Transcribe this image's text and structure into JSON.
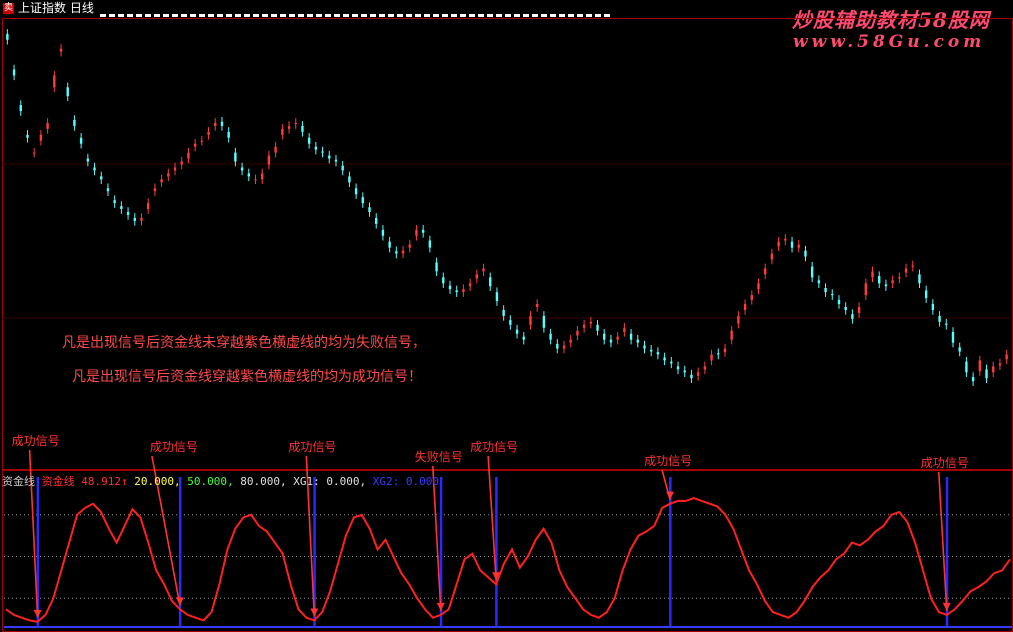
{
  "title_bar": {
    "icon_label": "卖",
    "title": "上证指数 日线"
  },
  "watermark": {
    "line1": "炒股辅助教材58股网",
    "line2": "www.58Gu.com"
  },
  "notes": [
    "凡是出现信号后资金线未穿越紫色横虚线的均为失败信号，",
    "凡是出现信号后资金线穿越紫色横虚线的均为成功信号！"
  ],
  "indicator_header": {
    "panel_name": "资金线",
    "series_name": "资金线",
    "value": "48.912",
    "arrow": "↑",
    "level1": "20.000,",
    "level2": "50.000,",
    "level3": "80.000,",
    "xg_label": "XG1:",
    "xg_value": "0.000,",
    "extra_label": "XG2:",
    "extra_value": "0.000"
  },
  "colors": {
    "background": "#000000",
    "frame": "#a00000",
    "candle_up": "#ff3b3b",
    "candle_down": "#54ffff",
    "line": "#ff2020",
    "signal_bar": "#2a2aff",
    "arrow": "#ff3333",
    "grid_dots": "#9a9a9a"
  },
  "chart_data": [
    {
      "type": "candlestick",
      "title": "上证指数 日线",
      "description_series": "close",
      "close": [
        2050,
        1990,
        1930,
        1885,
        1860,
        1890,
        1910,
        1990,
        2035,
        1955,
        1905,
        1875,
        1845,
        1830,
        1815,
        1795,
        1775,
        1765,
        1755,
        1745,
        1750,
        1775,
        1800,
        1815,
        1825,
        1835,
        1845,
        1860,
        1875,
        1880,
        1895,
        1910,
        1905,
        1885,
        1845,
        1830,
        1820,
        1815,
        1825,
        1855,
        1870,
        1900,
        1905,
        1910,
        1895,
        1875,
        1865,
        1860,
        1850,
        1845,
        1830,
        1810,
        1790,
        1775,
        1760,
        1740,
        1720,
        1700,
        1690,
        1695,
        1705,
        1730,
        1725,
        1700,
        1660,
        1640,
        1630,
        1625,
        1630,
        1640,
        1655,
        1665,
        1635,
        1610,
        1585,
        1570,
        1555,
        1545,
        1585,
        1605,
        1565,
        1545,
        1530,
        1535,
        1545,
        1560,
        1570,
        1575,
        1560,
        1545,
        1540,
        1550,
        1565,
        1545,
        1540,
        1530,
        1525,
        1520,
        1510,
        1505,
        1495,
        1490,
        1480,
        1490,
        1500,
        1520,
        1520,
        1530,
        1560,
        1585,
        1605,
        1620,
        1640,
        1665,
        1690,
        1710,
        1715,
        1700,
        1705,
        1685,
        1650,
        1640,
        1625,
        1620,
        1605,
        1595,
        1580,
        1600,
        1640,
        1660,
        1640,
        1635,
        1645,
        1650,
        1665,
        1670,
        1640,
        1615,
        1595,
        1575,
        1570,
        1540,
        1525,
        1490,
        1475,
        1510,
        1480,
        1500,
        1505,
        1520
      ],
      "open": [
        2060,
        2000,
        1940,
        1890,
        1860,
        1880,
        1900,
        1970,
        2030,
        1970,
        1915,
        1885,
        1850,
        1835,
        1820,
        1800,
        1780,
        1770,
        1760,
        1750,
        1745,
        1765,
        1795,
        1810,
        1820,
        1830,
        1840,
        1850,
        1870,
        1880,
        1890,
        1905,
        1912,
        1895,
        1860,
        1835,
        1825,
        1815,
        1815,
        1840,
        1860,
        1890,
        1900,
        1908,
        1905,
        1885,
        1870,
        1862,
        1855,
        1848,
        1838,
        1820,
        1800,
        1785,
        1768,
        1750,
        1730,
        1710,
        1694,
        1690,
        1700,
        1720,
        1730,
        1712,
        1675,
        1650,
        1636,
        1628,
        1625,
        1635,
        1648,
        1660,
        1650,
        1625,
        1595,
        1578,
        1562,
        1550,
        1570,
        1600,
        1585,
        1555,
        1538,
        1530,
        1540,
        1552,
        1565,
        1572,
        1570,
        1555,
        1545,
        1545,
        1558,
        1555,
        1545,
        1535,
        1528,
        1524,
        1515,
        1508,
        1500,
        1493,
        1486,
        1484,
        1495,
        1510,
        1522,
        1524,
        1545,
        1572,
        1595,
        1612,
        1630,
        1655,
        1680,
        1702,
        1712,
        1710,
        1700,
        1695,
        1668,
        1645,
        1632,
        1622,
        1612,
        1600,
        1588,
        1590,
        1620,
        1650,
        1652,
        1638,
        1640,
        1648,
        1658,
        1668,
        1655,
        1628,
        1605,
        1585,
        1572,
        1558,
        1532,
        1508,
        1482,
        1492,
        1495,
        1490,
        1502,
        1512
      ],
      "ylim": [
        1440,
        2080
      ]
    },
    {
      "type": "line",
      "title": "资金线",
      "ylim": [
        0,
        100
      ],
      "levels": [
        20,
        50,
        80
      ],
      "series": [
        {
          "name": "资金线",
          "values": [
            12,
            8,
            6,
            4,
            3,
            8,
            20,
            40,
            60,
            80,
            85,
            88,
            82,
            70,
            60,
            72,
            84,
            78,
            60,
            40,
            30,
            18,
            12,
            8,
            6,
            4,
            10,
            30,
            55,
            70,
            78,
            80,
            72,
            68,
            60,
            52,
            30,
            12,
            6,
            4,
            10,
            25,
            45,
            65,
            78,
            80,
            70,
            55,
            62,
            50,
            38,
            30,
            20,
            12,
            6,
            8,
            12,
            30,
            48,
            52,
            40,
            35,
            30,
            45,
            55,
            42,
            50,
            62,
            70,
            60,
            40,
            28,
            20,
            12,
            8,
            6,
            10,
            20,
            40,
            55,
            65,
            68,
            72,
            85,
            88,
            90,
            90,
            92,
            90,
            88,
            86,
            80,
            70,
            55,
            40,
            30,
            18,
            10,
            8,
            6,
            10,
            18,
            28,
            35,
            40,
            48,
            52,
            60,
            58,
            62,
            68,
            72,
            80,
            82,
            75,
            60,
            40,
            20,
            10,
            8,
            12,
            18,
            25,
            28,
            32,
            38,
            40,
            48
          ],
          "x": [
            0,
            1,
            2,
            3,
            4,
            5,
            6,
            7,
            8,
            9,
            10,
            11,
            12,
            13,
            14,
            15,
            16,
            17,
            18,
            19,
            20,
            21,
            22,
            23,
            24,
            25,
            26,
            27,
            28,
            29,
            30,
            31,
            32,
            33,
            34,
            35,
            36,
            37,
            38,
            39,
            40,
            41,
            42,
            43,
            44,
            45,
            46,
            47,
            48,
            49,
            50,
            51,
            52,
            53,
            54,
            55,
            56,
            57,
            58,
            59,
            60,
            61,
            62,
            63,
            64,
            65,
            66,
            67,
            68,
            69,
            70,
            71,
            72,
            73,
            74,
            75,
            76,
            77,
            78,
            79,
            80,
            81,
            82,
            83,
            84,
            85,
            86,
            87,
            88,
            89,
            90,
            91,
            92,
            93,
            94,
            95,
            96,
            97,
            98,
            99,
            100,
            101,
            102,
            103,
            104,
            105,
            106,
            107,
            108,
            109,
            110,
            111,
            112,
            113,
            114,
            115,
            116,
            117,
            118,
            119,
            120,
            121,
            122,
            123,
            124,
            125,
            126,
            127
          ]
        }
      ],
      "signals": [
        {
          "label": "成功信号",
          "index": 4
        },
        {
          "label": "成功信号",
          "index": 22
        },
        {
          "label": "成功信号",
          "index": 39
        },
        {
          "label": "失败信号",
          "index": 55
        },
        {
          "label": "成功信号",
          "index": 62
        },
        {
          "label": "成功信号",
          "index": 84
        },
        {
          "label": "成功信号",
          "index": 119
        }
      ]
    }
  ]
}
